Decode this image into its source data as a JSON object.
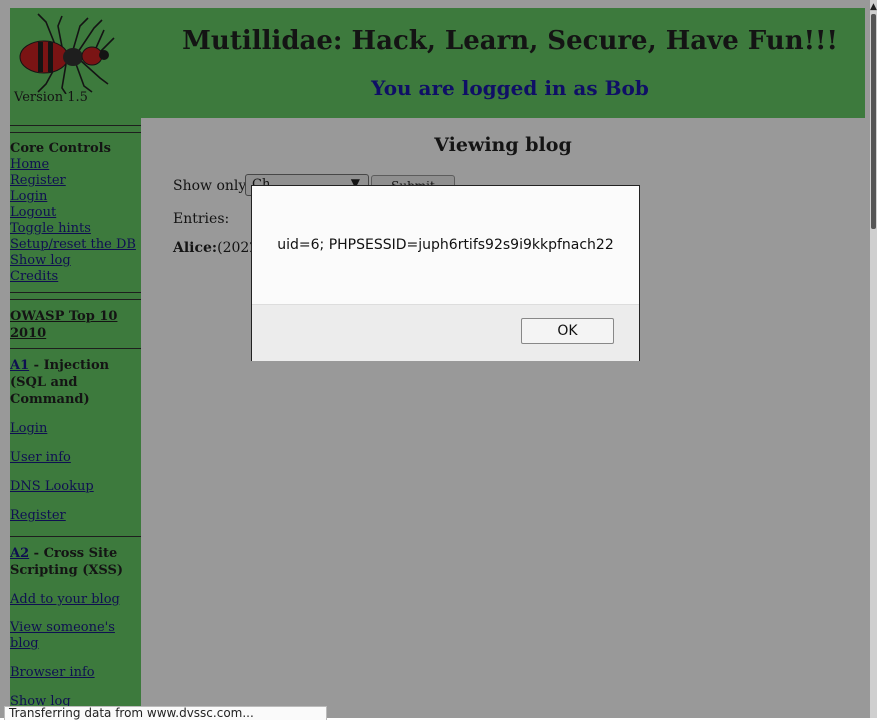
{
  "header": {
    "title": "Mutillidae: Hack, Learn, Secure, Have Fun!!!",
    "login_status": "You are logged in as Bob",
    "version": "Version 1.5"
  },
  "sidebar": {
    "core_heading": "Core Controls",
    "core_links": [
      "Home",
      "Register",
      "Login",
      "Logout",
      "Toggle hints",
      "Setup/reset the DB",
      "Show log",
      "Credits"
    ],
    "owasp_heading": "OWASP Top 10 2010",
    "a1": {
      "code": "A1",
      "title": " - Injection (SQL and Command)",
      "items": [
        "Login",
        "User info",
        "DNS Lookup",
        "Register"
      ]
    },
    "a2": {
      "code": "A2",
      "title": " - Cross Site Scripting (XSS)",
      "items": [
        "Add to your blog",
        "View someone's blog",
        "Browser info",
        "Show log"
      ]
    }
  },
  "main": {
    "title": "Viewing blog",
    "show_only_label": "Show only:",
    "select_value": "Ch",
    "submit_label": "Submit",
    "entries_label": "Entries:",
    "entry_author": "Alice:",
    "entry_text": "(2022"
  },
  "dialog": {
    "message": "uid=6; PHPSESSID=juph6rtifs92s9i9kkpfnach22",
    "ok_label": "OK"
  },
  "status_bar": {
    "text": "Transferring data from www.dvssc.com..."
  },
  "colors": {
    "header_green": "#66cc66",
    "login_blue": "#1a1aaa",
    "overlay": "rgba(0,0,0,0.4)"
  }
}
